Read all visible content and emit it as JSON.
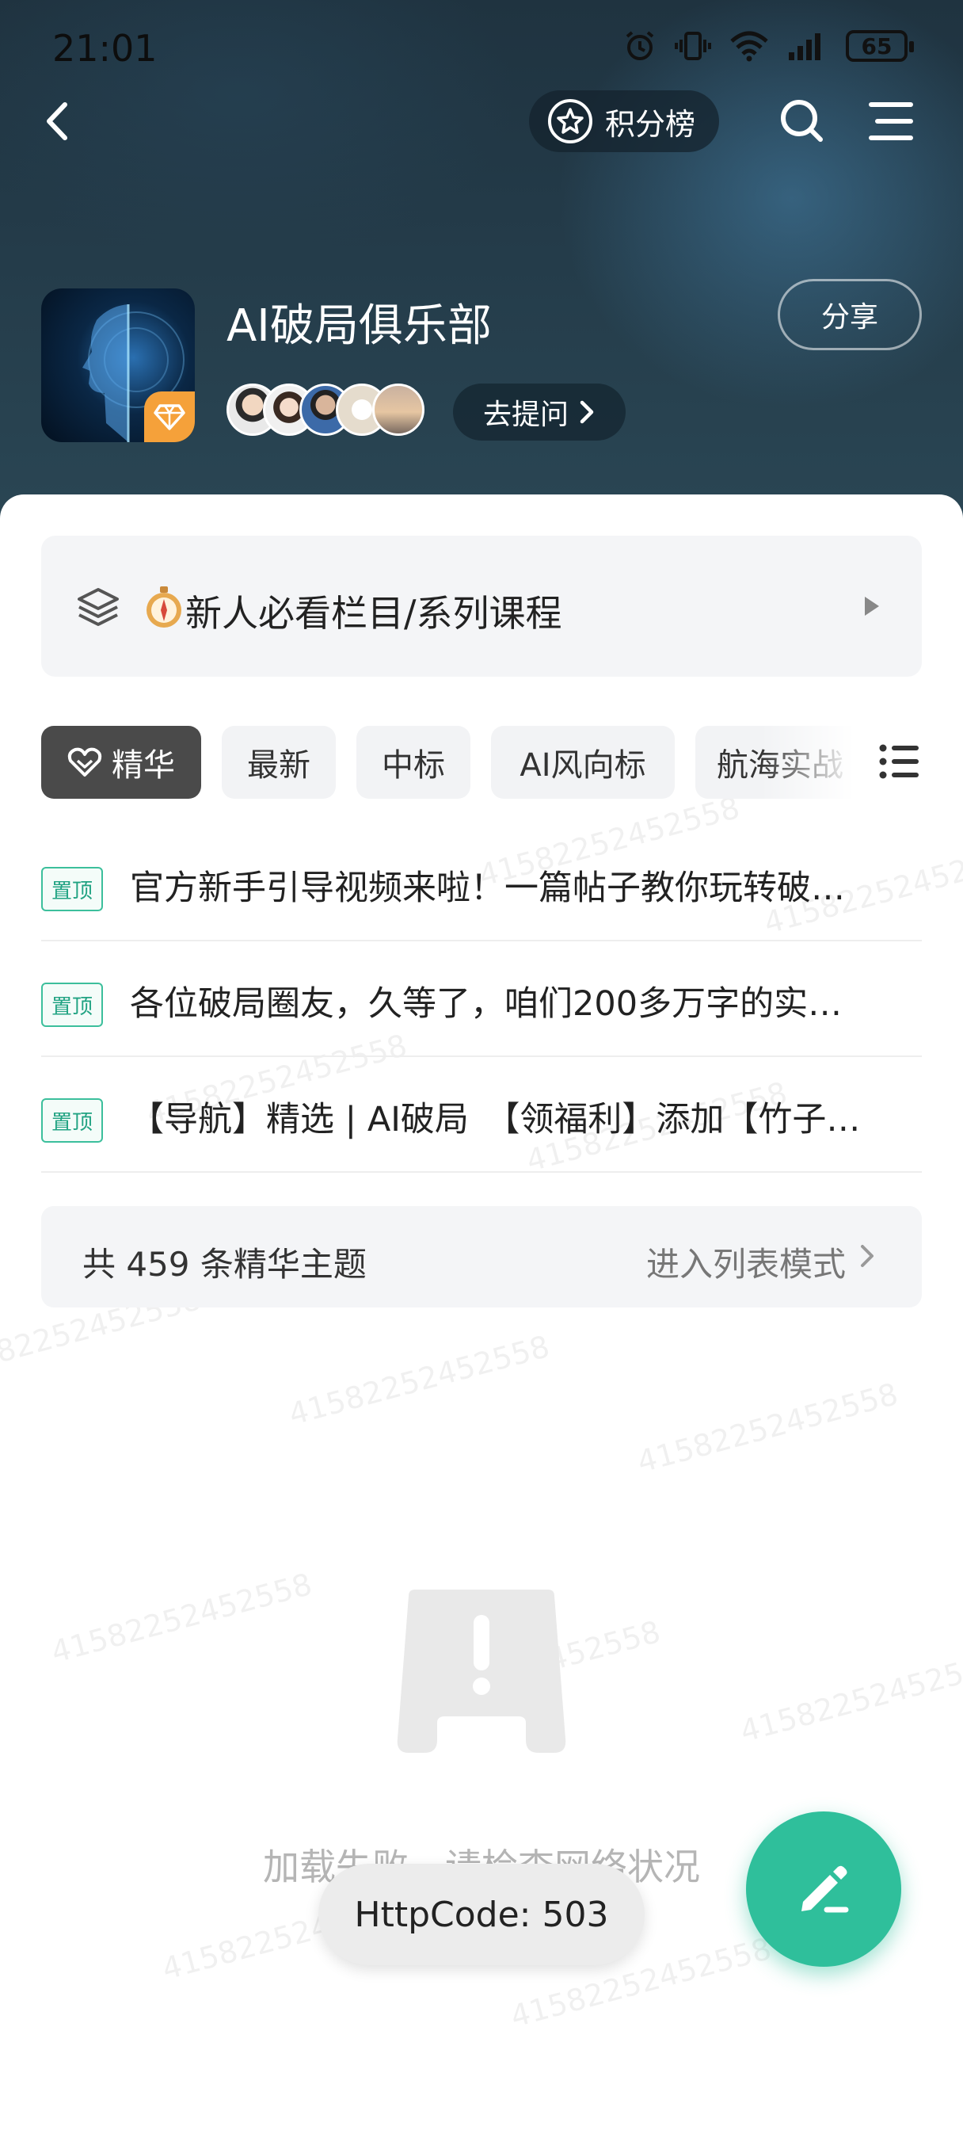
{
  "status_bar": {
    "time": "21:01",
    "battery": "65"
  },
  "header": {
    "points_label": "积分榜",
    "club_name": "AI破局俱乐部",
    "share_label": "分享",
    "ask_label": "去提问"
  },
  "column_card": {
    "label": "新人必看栏目/系列课程"
  },
  "tabs": [
    {
      "label": "精华"
    },
    {
      "label": "最新"
    },
    {
      "label": "中标"
    },
    {
      "label": "AI风向标"
    },
    {
      "label": "航海实战"
    }
  ],
  "pinned": [
    {
      "badge": "置顶",
      "title": "官方新手引导视频来啦！一篇帖子教你玩转破…"
    },
    {
      "badge": "置顶",
      "title": "各位破局圈友，久等了，咱们200多万字的实…"
    },
    {
      "badge": "置顶",
      "title": "【导航】精选 | AI破局　【领福利】添加【竹子…"
    }
  ],
  "summary": {
    "count_text": "共 459 条精华主题",
    "list_mode_label": "进入列表模式"
  },
  "error": {
    "message": "加载失败，请检查网络状况"
  },
  "toast": {
    "text": "HttpCode: 503"
  },
  "watermark": {
    "text": "41582252452558"
  },
  "colors": {
    "accent": "#2fbf9b",
    "active_tab": "#4a4a4a",
    "gem": "#f5a13a"
  }
}
